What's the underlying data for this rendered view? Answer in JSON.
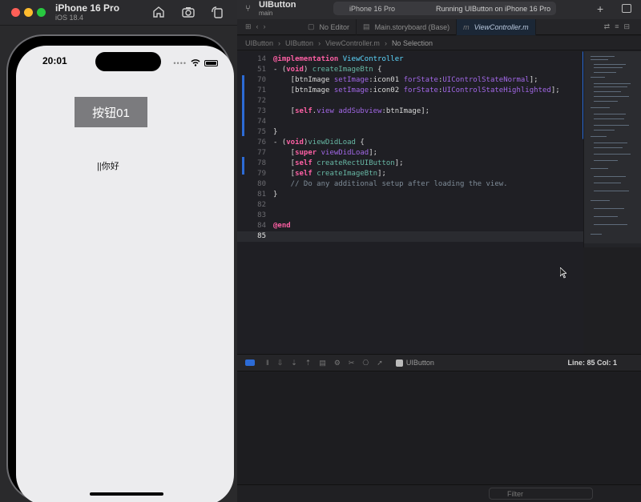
{
  "simulator": {
    "title": "iPhone 16 Pro",
    "os": "iOS 18.4",
    "toolbar_icons": [
      "home-icon",
      "screenshot-icon",
      "rotate-icon"
    ],
    "status_time": "20:01",
    "button_label": "按钮01",
    "label_text": "||你好"
  },
  "xcode": {
    "project": "UIButton",
    "branch": "main",
    "device": "iPhone 16 Pro",
    "run_status": "Running UIButton on iPhone 16 Pro",
    "tabs": [
      {
        "label": "No Editor",
        "active": false
      },
      {
        "label": "Main.storyboard (Base)",
        "active": false
      },
      {
        "label": "ViewController.m",
        "active": true
      }
    ],
    "jumpbar": [
      "UIButton",
      "UIButton",
      "ViewController.m",
      "No Selection"
    ],
    "debug_target": "UIButton",
    "cursor_pos": "Line: 85  Col: 1",
    "filter_placeholder": "Filter",
    "code": [
      {
        "n": "14",
        "t": "@implementation ViewController"
      },
      {
        "n": "51",
        "t": "- (void) createImageBtn {"
      },
      {
        "n": "70",
        "t": "    [btnImage setImage:icon01 forState:UIControlStateNormal];"
      },
      {
        "n": "71",
        "t": "    [btnImage setImage:icon02 forState:UIControlStateHighlighted];"
      },
      {
        "n": "72",
        "t": ""
      },
      {
        "n": "73",
        "t": "    [self.view addSubview:btnImage];"
      },
      {
        "n": "74",
        "t": ""
      },
      {
        "n": "75",
        "t": "}"
      },
      {
        "n": "76",
        "t": "- (void)viewDidLoad {"
      },
      {
        "n": "77",
        "t": "    [super viewDidLoad];"
      },
      {
        "n": "78",
        "t": "    [self createRectUIButton];"
      },
      {
        "n": "79",
        "t": "    [self createImageBtn];"
      },
      {
        "n": "80",
        "t": "    // Do any additional setup after loading the view."
      },
      {
        "n": "81",
        "t": "}"
      },
      {
        "n": "82",
        "t": ""
      },
      {
        "n": "83",
        "t": ""
      },
      {
        "n": "84",
        "t": "@end"
      },
      {
        "n": "85",
        "t": ""
      }
    ]
  },
  "colors": {
    "accent": "#2c6bd6",
    "keyword": "#fc5fa3",
    "type": "#5dd8ff"
  }
}
